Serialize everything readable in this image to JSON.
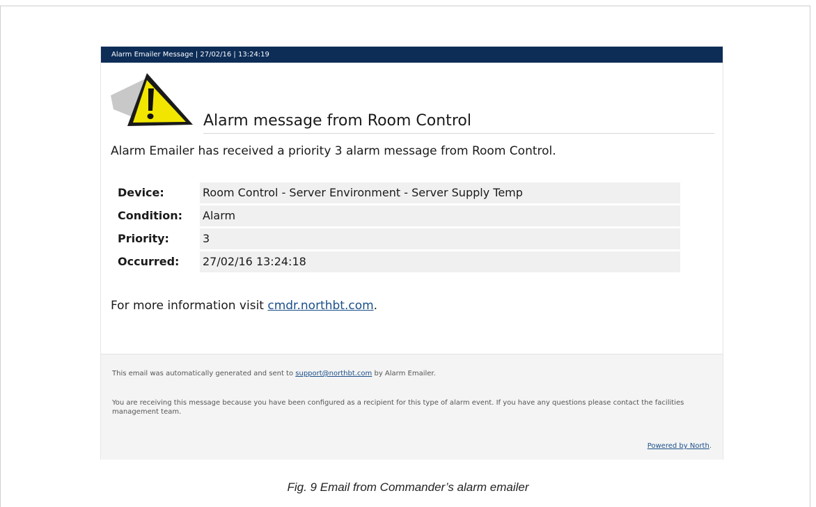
{
  "email": {
    "header": "Alarm Emailer Message | 27/02/16 | 13:24:19",
    "title": "Alarm message from Room Control",
    "intro": "Alarm Emailer has received a priority 3 alarm message from Room Control.",
    "details": [
      {
        "label": "Device:",
        "value": "Room Control - Server Environment - Server Supply Temp"
      },
      {
        "label": "Condition:",
        "value": "Alarm"
      },
      {
        "label": "Priority:",
        "value": "3"
      },
      {
        "label": "Occurred:",
        "value": "27/02/16 13:24:18"
      }
    ],
    "more_info": {
      "prefix": "For more information visit ",
      "link_text": "cmdr.northbt.com",
      "suffix": "."
    },
    "footer": {
      "line1_prefix": "This email was automatically generated and sent to ",
      "line1_link": "support@northbt.com",
      "line1_suffix": " by Alarm Emailer.",
      "line2": "You are receiving this message because you have been configured as a recipient for this type of alarm event. If you have any questions please contact the facilities management team.",
      "powered_link": "Powered by North",
      "powered_suffix": "."
    }
  },
  "caption": "Fig. 9 Email from Commander’s alarm emailer",
  "icons": {
    "warning": "warning-triangle-icon"
  },
  "colors": {
    "header_bg": "#0d2d57",
    "link": "#1a4f8a",
    "warning_yellow": "#f2e600",
    "row_bg": "#f0f0f0"
  }
}
